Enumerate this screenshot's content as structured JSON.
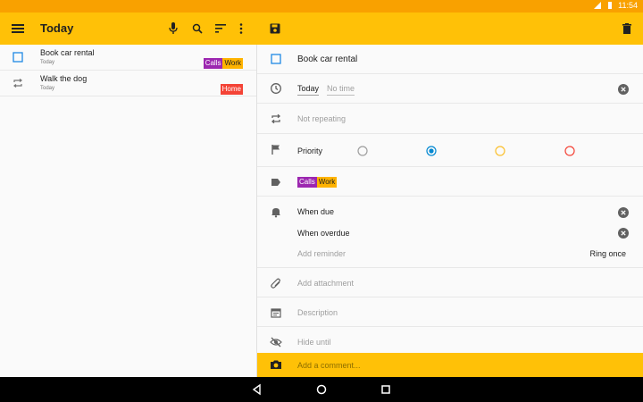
{
  "status": {
    "time": "11:54"
  },
  "list": {
    "title": "Today",
    "tasks": [
      {
        "title": "Book car rental",
        "due": "Today",
        "tags": [
          {
            "label": "Calls",
            "color": "#9c27b0"
          },
          {
            "label": "Work",
            "color": "#ffb300"
          }
        ]
      },
      {
        "title": "Walk the dog",
        "due": "Today",
        "tags": [
          {
            "label": "Home",
            "color": "#f44336"
          }
        ]
      }
    ],
    "fab": "+"
  },
  "edit": {
    "task_title": "Book car rental",
    "due_date": "Today",
    "due_time": "No time",
    "repeat": "Not repeating",
    "priority_label": "Priority",
    "priority_colors": [
      "#9e9e9e",
      "#0288d1",
      "#fbc02d",
      "#f44336"
    ],
    "selected_priority": 1,
    "tags": [
      {
        "label": "Calls",
        "color": "#9c27b0"
      },
      {
        "label": "Work",
        "color": "#ffb300"
      }
    ],
    "reminders": [
      "When due",
      "When overdue"
    ],
    "add_reminder": "Add reminder",
    "ring_mode": "Ring once",
    "add_attachment": "Add attachment",
    "description": "Description",
    "hide_until": "Hide until",
    "comment_placeholder": "Add a comment..."
  }
}
